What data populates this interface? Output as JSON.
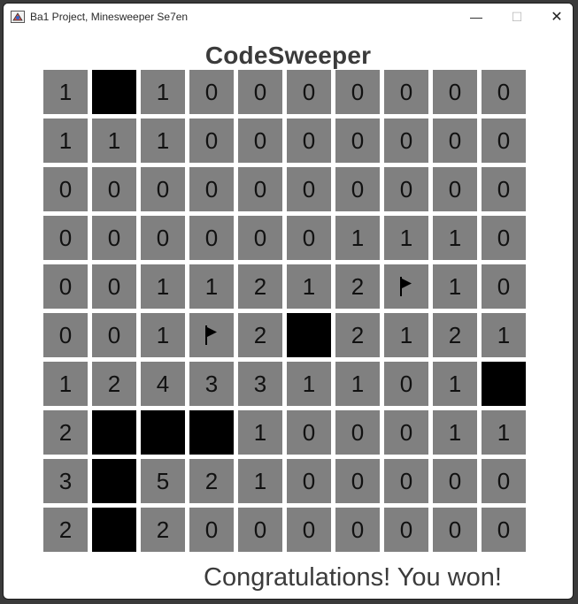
{
  "window": {
    "title": "Ba1 Project, Minesweeper Se7en",
    "minimize_glyph": "—",
    "maximize_glyph": "☐",
    "close_glyph": "✕"
  },
  "game": {
    "title": "CodeSweeper",
    "status": "Congratulations! You won!",
    "colors": {
      "cell": "#808080",
      "mine": "#000000",
      "text": "#111111"
    },
    "board": [
      [
        "1",
        "M",
        "1",
        "0",
        "0",
        "0",
        "0",
        "0",
        "0",
        "0"
      ],
      [
        "1",
        "1",
        "1",
        "0",
        "0",
        "0",
        "0",
        "0",
        "0",
        "0"
      ],
      [
        "0",
        "0",
        "0",
        "0",
        "0",
        "0",
        "0",
        "0",
        "0",
        "0"
      ],
      [
        "0",
        "0",
        "0",
        "0",
        "0",
        "0",
        "1",
        "1",
        "1",
        "0"
      ],
      [
        "0",
        "0",
        "1",
        "1",
        "2",
        "1",
        "2",
        "F",
        "1",
        "0"
      ],
      [
        "0",
        "0",
        "1",
        "F",
        "2",
        "M",
        "2",
        "1",
        "2",
        "1"
      ],
      [
        "1",
        "2",
        "4",
        "3",
        "3",
        "1",
        "1",
        "0",
        "1",
        "M"
      ],
      [
        "2",
        "M",
        "M",
        "M",
        "1",
        "0",
        "0",
        "0",
        "1",
        "1"
      ],
      [
        "3",
        "M",
        "5",
        "2",
        "1",
        "0",
        "0",
        "0",
        "0",
        "0"
      ],
      [
        "2",
        "M",
        "2",
        "0",
        "0",
        "0",
        "0",
        "0",
        "0",
        "0"
      ]
    ]
  }
}
